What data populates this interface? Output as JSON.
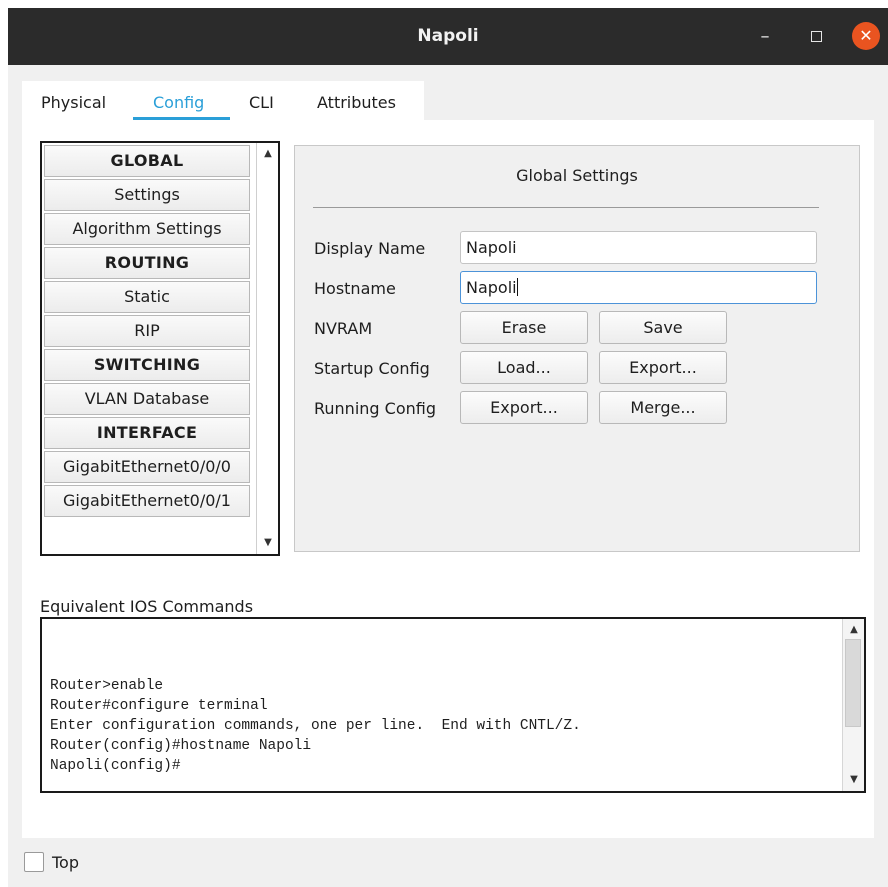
{
  "window": {
    "title": "Napoli",
    "controls": {
      "minimize": "–",
      "maximize": "",
      "close": "✕"
    }
  },
  "tabs": [
    {
      "label": "Physical",
      "active": false
    },
    {
      "label": "Config",
      "active": true
    },
    {
      "label": "CLI",
      "active": false
    },
    {
      "label": "Attributes",
      "active": false
    }
  ],
  "nav": {
    "items": [
      {
        "label": "GLOBAL",
        "header": true
      },
      {
        "label": "Settings",
        "header": false
      },
      {
        "label": "Algorithm Settings",
        "header": false
      },
      {
        "label": "ROUTING",
        "header": true
      },
      {
        "label": "Static",
        "header": false
      },
      {
        "label": "RIP",
        "header": false
      },
      {
        "label": "SWITCHING",
        "header": true
      },
      {
        "label": "VLAN Database",
        "header": false
      },
      {
        "label": "INTERFACE",
        "header": true
      },
      {
        "label": "GigabitEthernet0/0/0",
        "header": false
      },
      {
        "label": "GigabitEthernet0/0/1",
        "header": false
      }
    ]
  },
  "global_settings": {
    "title": "Global Settings",
    "display_name_label": "Display Name",
    "display_name_value": "Napoli",
    "hostname_label": "Hostname",
    "hostname_value": "Napoli",
    "nvram_label": "NVRAM",
    "erase_button": "Erase",
    "save_button": "Save",
    "startup_config_label": "Startup Config",
    "load_button": "Load...",
    "startup_export_button": "Export...",
    "running_config_label": "Running Config",
    "running_export_button": "Export...",
    "merge_button": "Merge..."
  },
  "ios": {
    "label": "Equivalent IOS Commands",
    "lines": [
      "Router>enable",
      "Router#configure terminal",
      "Enter configuration commands, one per line.  End with CNTL/Z.",
      "Router(config)#hostname Napoli",
      "Napoli(config)#"
    ]
  },
  "footer": {
    "top_checkbox_label": "Top",
    "top_checked": false
  },
  "colors": {
    "accent": "#2a9fd8",
    "titlebar": "#2b2b2b",
    "close_button": "#e95420"
  }
}
